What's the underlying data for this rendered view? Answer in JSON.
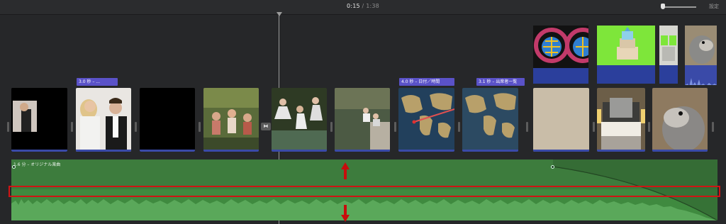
{
  "header": {
    "current_time": "0:15",
    "separator": "/",
    "total_time": "1:38",
    "settings_label": "設定"
  },
  "clips": {
    "titles": [
      "3.0 秒 – ...",
      "4.0 秒 – 日付／時間",
      "3.1 秒 – 出席者一覧"
    ]
  },
  "audio": {
    "label": "1.6 分 – オリジナル楽曲"
  },
  "icons": {
    "transition": "transition-icon",
    "playhead": "playhead-marker",
    "zoom": "zoom-slider-icon"
  },
  "colors": {
    "timeline_bg": "#262729",
    "title_bar": "#5a52c8",
    "audio_track": "#3f8a3f",
    "highlight": "#d01414",
    "annotation_arrow": "#c80c0c"
  }
}
